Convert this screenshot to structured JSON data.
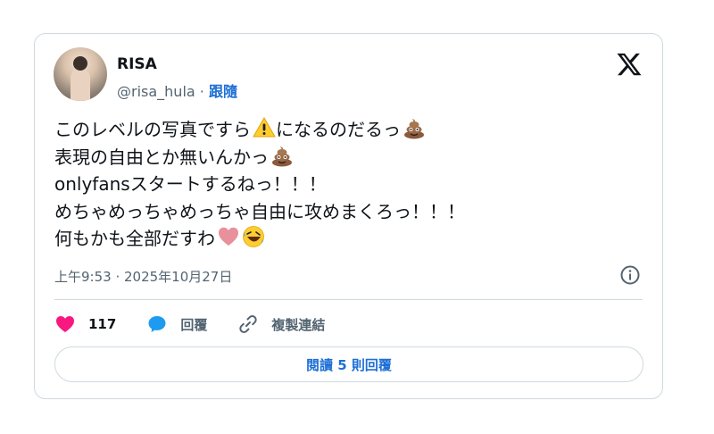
{
  "author": {
    "name": "RISA",
    "handle": "@risa_hula",
    "separator": "·",
    "follow_label": "跟隨"
  },
  "tweet": {
    "lines": [
      {
        "text": "このレベルの写真ですら",
        "emoji_after": "warning-emoji",
        "text2": "になるのだるっ",
        "emoji_end": "poop-emoji"
      },
      {
        "text": "表現の自由とか無いんかっ",
        "emoji_end": "poop-emoji"
      },
      {
        "text": "onlyfansスタートするねっ！！！"
      },
      {
        "text": "めちゃめっちゃめっちゃ自由に攻めまくろっ！！！"
      },
      {
        "text": "何もかも全部だすわ",
        "emoji_end": "heart-emoji",
        "emoji_end2": "rofl-emoji"
      }
    ]
  },
  "timestamp": "上午9:53 · 2025年10月27日",
  "actions": {
    "like_count": "117",
    "reply_label": "回覆",
    "copy_link_label": "複製連結"
  },
  "reply_button_label": "閱讀 5 則回覆",
  "colors": {
    "accent": "#1d6fd6",
    "like": "#f91880",
    "reply_icon": "#1d9bf0",
    "border": "#cfd9de"
  }
}
